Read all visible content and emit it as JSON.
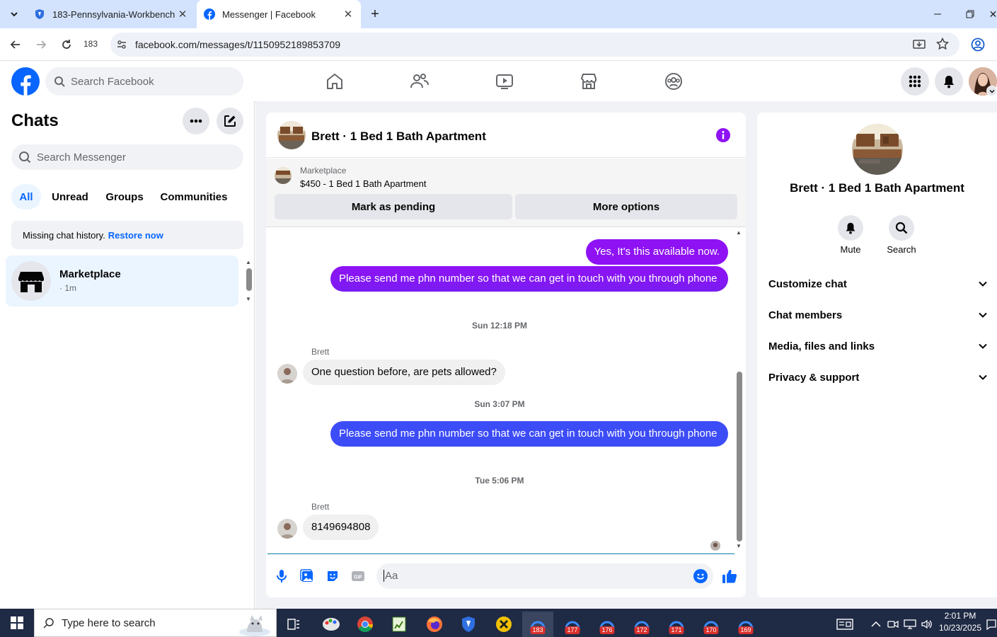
{
  "browser": {
    "tabs": [
      {
        "title": "183-Pennsylvania-Workbench",
        "active": false
      },
      {
        "title": "Messenger | Facebook",
        "active": true
      }
    ],
    "new_tab_symbol": "+",
    "profile_label": "183",
    "url": "facebook.com/messages/t/1150952189853709"
  },
  "facebook": {
    "search_placeholder": "Search Facebook",
    "brand_color": "#0866ff"
  },
  "chats": {
    "title": "Chats",
    "search_placeholder": "Search Messenger",
    "filters": [
      "All",
      "Unread",
      "Groups",
      "Communities"
    ],
    "active_filter": "All",
    "notice_text": "Missing chat history.",
    "notice_link": "Restore now",
    "items": [
      {
        "name": "Marketplace",
        "meta": "· 1m"
      }
    ]
  },
  "conversation": {
    "title": "Brett · 1 Bed 1 Bath Apartment",
    "listing_label": "Marketplace",
    "listing_title": "$450 - 1 Bed 1 Bath Apartment",
    "mark_pending_label": "Mark as pending",
    "more_options_label": "More options",
    "messages": [
      {
        "type": "out",
        "text": "Yes, It's this available now."
      },
      {
        "type": "out",
        "text": "Please send me  phn  number so that we can get in touch with you through phone"
      },
      {
        "type": "stamp",
        "text": "Sun 12:18 PM"
      },
      {
        "type": "sender",
        "text": "Brett"
      },
      {
        "type": "in",
        "text": "One question before, are pets allowed?"
      },
      {
        "type": "stamp",
        "text": "Sun 3:07 PM"
      },
      {
        "type": "out",
        "text": "Please send me  phn  number so that we can get in touch with you through phone"
      },
      {
        "type": "stamp",
        "text": "Tue 5:06 PM"
      },
      {
        "type": "sender",
        "text": "Brett"
      },
      {
        "type": "in",
        "text": "8149694808"
      }
    ],
    "composer_placeholder": "Aa",
    "outgoing_color_top": "#8e12f4",
    "outgoing_color_bottom": "#3c4cf7"
  },
  "details": {
    "name": "Brett · 1 Bed 1 Bath Apartment",
    "actions": [
      "Mute",
      "Search"
    ],
    "sections": [
      "Customize chat",
      "Chat members",
      "Media, files and links",
      "Privacy & support"
    ]
  },
  "taskbar": {
    "search_placeholder": "Type here to search",
    "time": "2:01 PM",
    "date": "10/23/2025",
    "badges": [
      "183",
      "177",
      "176",
      "172",
      "171",
      "170",
      "169"
    ]
  }
}
